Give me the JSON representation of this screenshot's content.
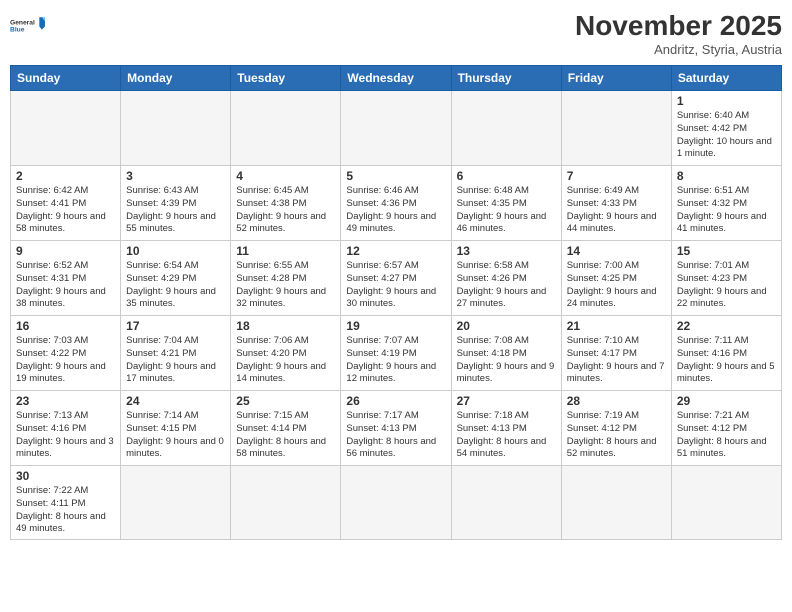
{
  "logo": {
    "text_general": "General",
    "text_blue": "Blue"
  },
  "title": "November 2025",
  "location": "Andritz, Styria, Austria",
  "weekdays": [
    "Sunday",
    "Monday",
    "Tuesday",
    "Wednesday",
    "Thursday",
    "Friday",
    "Saturday"
  ],
  "weeks": [
    [
      {
        "day": "",
        "empty": true,
        "info": ""
      },
      {
        "day": "",
        "empty": true,
        "info": ""
      },
      {
        "day": "",
        "empty": true,
        "info": ""
      },
      {
        "day": "",
        "empty": true,
        "info": ""
      },
      {
        "day": "",
        "empty": true,
        "info": ""
      },
      {
        "day": "",
        "empty": true,
        "info": ""
      },
      {
        "day": "1",
        "empty": false,
        "info": "Sunrise: 6:40 AM\nSunset: 4:42 PM\nDaylight: 10 hours\nand 1 minute."
      }
    ],
    [
      {
        "day": "2",
        "empty": false,
        "info": "Sunrise: 6:42 AM\nSunset: 4:41 PM\nDaylight: 9 hours\nand 58 minutes."
      },
      {
        "day": "3",
        "empty": false,
        "info": "Sunrise: 6:43 AM\nSunset: 4:39 PM\nDaylight: 9 hours\nand 55 minutes."
      },
      {
        "day": "4",
        "empty": false,
        "info": "Sunrise: 6:45 AM\nSunset: 4:38 PM\nDaylight: 9 hours\nand 52 minutes."
      },
      {
        "day": "5",
        "empty": false,
        "info": "Sunrise: 6:46 AM\nSunset: 4:36 PM\nDaylight: 9 hours\nand 49 minutes."
      },
      {
        "day": "6",
        "empty": false,
        "info": "Sunrise: 6:48 AM\nSunset: 4:35 PM\nDaylight: 9 hours\nand 46 minutes."
      },
      {
        "day": "7",
        "empty": false,
        "info": "Sunrise: 6:49 AM\nSunset: 4:33 PM\nDaylight: 9 hours\nand 44 minutes."
      },
      {
        "day": "8",
        "empty": false,
        "info": "Sunrise: 6:51 AM\nSunset: 4:32 PM\nDaylight: 9 hours\nand 41 minutes."
      }
    ],
    [
      {
        "day": "9",
        "empty": false,
        "info": "Sunrise: 6:52 AM\nSunset: 4:31 PM\nDaylight: 9 hours\nand 38 minutes."
      },
      {
        "day": "10",
        "empty": false,
        "info": "Sunrise: 6:54 AM\nSunset: 4:29 PM\nDaylight: 9 hours\nand 35 minutes."
      },
      {
        "day": "11",
        "empty": false,
        "info": "Sunrise: 6:55 AM\nSunset: 4:28 PM\nDaylight: 9 hours\nand 32 minutes."
      },
      {
        "day": "12",
        "empty": false,
        "info": "Sunrise: 6:57 AM\nSunset: 4:27 PM\nDaylight: 9 hours\nand 30 minutes."
      },
      {
        "day": "13",
        "empty": false,
        "info": "Sunrise: 6:58 AM\nSunset: 4:26 PM\nDaylight: 9 hours\nand 27 minutes."
      },
      {
        "day": "14",
        "empty": false,
        "info": "Sunrise: 7:00 AM\nSunset: 4:25 PM\nDaylight: 9 hours\nand 24 minutes."
      },
      {
        "day": "15",
        "empty": false,
        "info": "Sunrise: 7:01 AM\nSunset: 4:23 PM\nDaylight: 9 hours\nand 22 minutes."
      }
    ],
    [
      {
        "day": "16",
        "empty": false,
        "info": "Sunrise: 7:03 AM\nSunset: 4:22 PM\nDaylight: 9 hours\nand 19 minutes."
      },
      {
        "day": "17",
        "empty": false,
        "info": "Sunrise: 7:04 AM\nSunset: 4:21 PM\nDaylight: 9 hours\nand 17 minutes."
      },
      {
        "day": "18",
        "empty": false,
        "info": "Sunrise: 7:06 AM\nSunset: 4:20 PM\nDaylight: 9 hours\nand 14 minutes."
      },
      {
        "day": "19",
        "empty": false,
        "info": "Sunrise: 7:07 AM\nSunset: 4:19 PM\nDaylight: 9 hours\nand 12 minutes."
      },
      {
        "day": "20",
        "empty": false,
        "info": "Sunrise: 7:08 AM\nSunset: 4:18 PM\nDaylight: 9 hours\nand 9 minutes."
      },
      {
        "day": "21",
        "empty": false,
        "info": "Sunrise: 7:10 AM\nSunset: 4:17 PM\nDaylight: 9 hours\nand 7 minutes."
      },
      {
        "day": "22",
        "empty": false,
        "info": "Sunrise: 7:11 AM\nSunset: 4:16 PM\nDaylight: 9 hours\nand 5 minutes."
      }
    ],
    [
      {
        "day": "23",
        "empty": false,
        "info": "Sunrise: 7:13 AM\nSunset: 4:16 PM\nDaylight: 9 hours\nand 3 minutes."
      },
      {
        "day": "24",
        "empty": false,
        "info": "Sunrise: 7:14 AM\nSunset: 4:15 PM\nDaylight: 9 hours\nand 0 minutes."
      },
      {
        "day": "25",
        "empty": false,
        "info": "Sunrise: 7:15 AM\nSunset: 4:14 PM\nDaylight: 8 hours\nand 58 minutes."
      },
      {
        "day": "26",
        "empty": false,
        "info": "Sunrise: 7:17 AM\nSunset: 4:13 PM\nDaylight: 8 hours\nand 56 minutes."
      },
      {
        "day": "27",
        "empty": false,
        "info": "Sunrise: 7:18 AM\nSunset: 4:13 PM\nDaylight: 8 hours\nand 54 minutes."
      },
      {
        "day": "28",
        "empty": false,
        "info": "Sunrise: 7:19 AM\nSunset: 4:12 PM\nDaylight: 8 hours\nand 52 minutes."
      },
      {
        "day": "29",
        "empty": false,
        "info": "Sunrise: 7:21 AM\nSunset: 4:12 PM\nDaylight: 8 hours\nand 51 minutes."
      }
    ],
    [
      {
        "day": "30",
        "empty": false,
        "info": "Sunrise: 7:22 AM\nSunset: 4:11 PM\nDaylight: 8 hours\nand 49 minutes."
      },
      {
        "day": "",
        "empty": true,
        "info": ""
      },
      {
        "day": "",
        "empty": true,
        "info": ""
      },
      {
        "day": "",
        "empty": true,
        "info": ""
      },
      {
        "day": "",
        "empty": true,
        "info": ""
      },
      {
        "day": "",
        "empty": true,
        "info": ""
      },
      {
        "day": "",
        "empty": true,
        "info": ""
      }
    ]
  ]
}
